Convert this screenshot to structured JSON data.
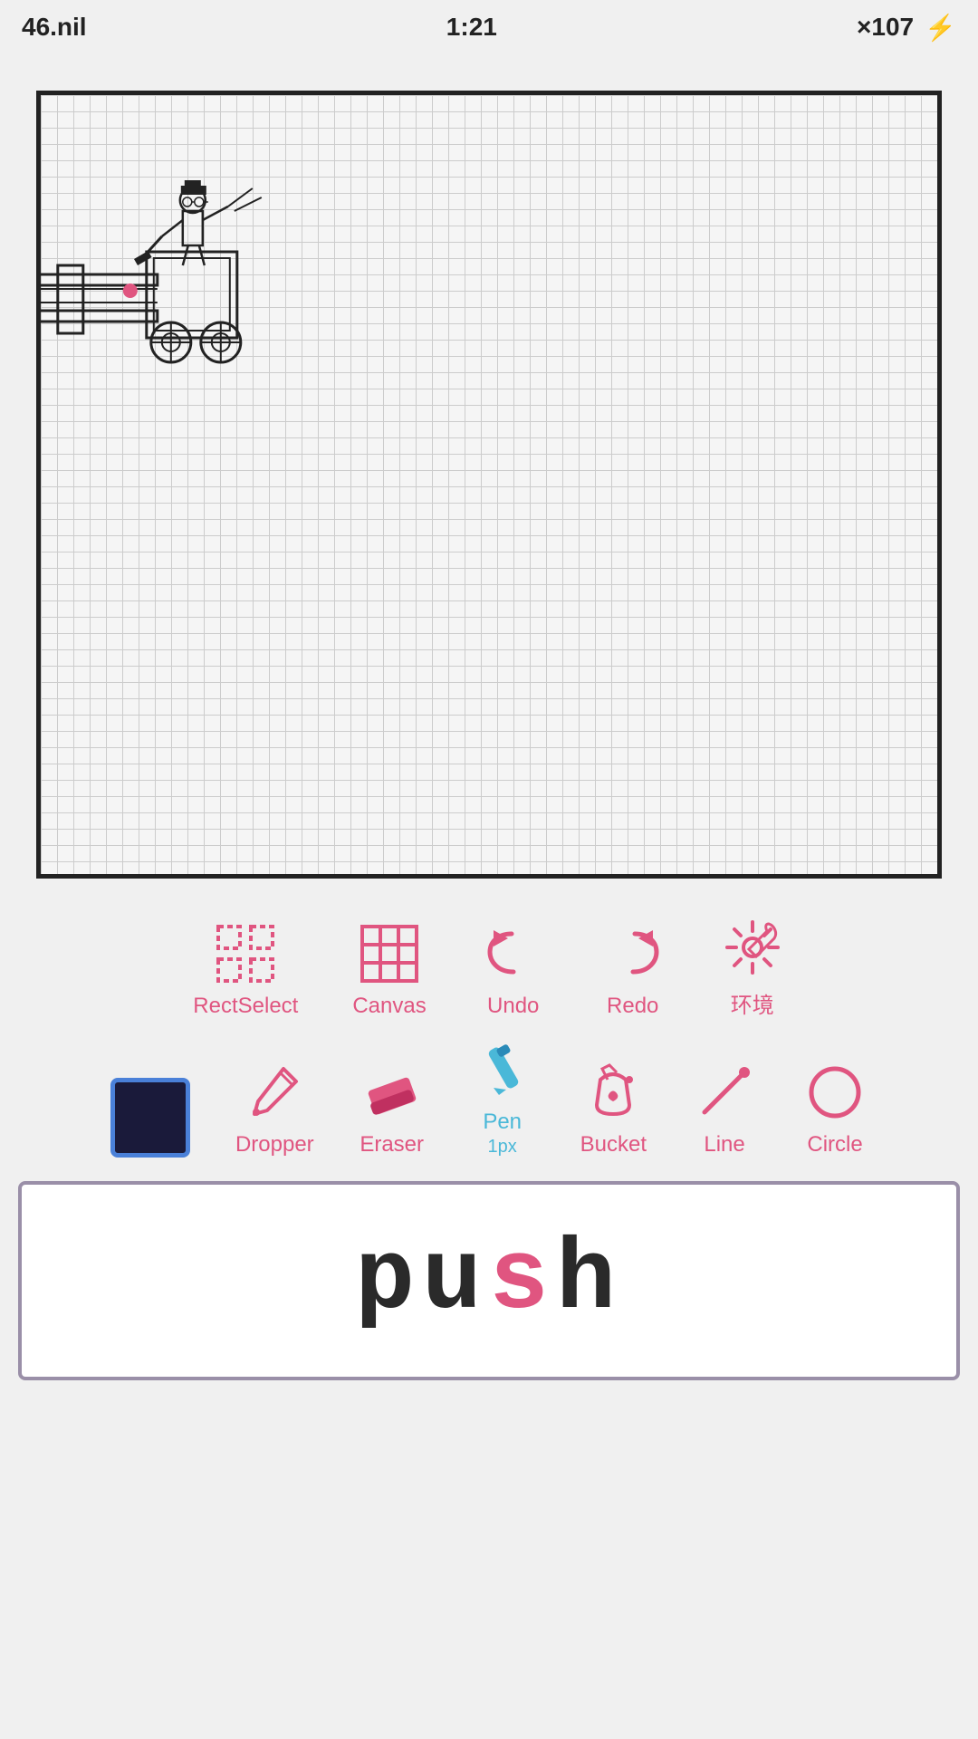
{
  "statusBar": {
    "left": "46.nil",
    "center": "1:21",
    "right": "×107",
    "battery_icon": "lightning-bolt"
  },
  "toolbar1": {
    "items": [
      {
        "id": "rect-select",
        "label": "RectSelect"
      },
      {
        "id": "canvas",
        "label": "Canvas"
      },
      {
        "id": "undo",
        "label": "Undo"
      },
      {
        "id": "redo",
        "label": "Redo"
      },
      {
        "id": "settings",
        "label": "环境"
      }
    ]
  },
  "toolbar2": {
    "items": [
      {
        "id": "color-picker",
        "label": ""
      },
      {
        "id": "dropper",
        "label": "Dropper"
      },
      {
        "id": "eraser",
        "label": "Eraser"
      },
      {
        "id": "pen",
        "label": "Pen",
        "sublabel": "1px"
      },
      {
        "id": "bucket",
        "label": "Bucket"
      },
      {
        "id": "line",
        "label": "Line"
      },
      {
        "id": "circle",
        "label": "Circle"
      }
    ]
  },
  "pushButton": {
    "label": "push"
  },
  "colors": {
    "pink": "#e05580",
    "cyan": "#4ab8d8",
    "dark": "#2a2a2a",
    "swatch": "#1a1a3a",
    "swatchBorder": "#4a80d8"
  }
}
